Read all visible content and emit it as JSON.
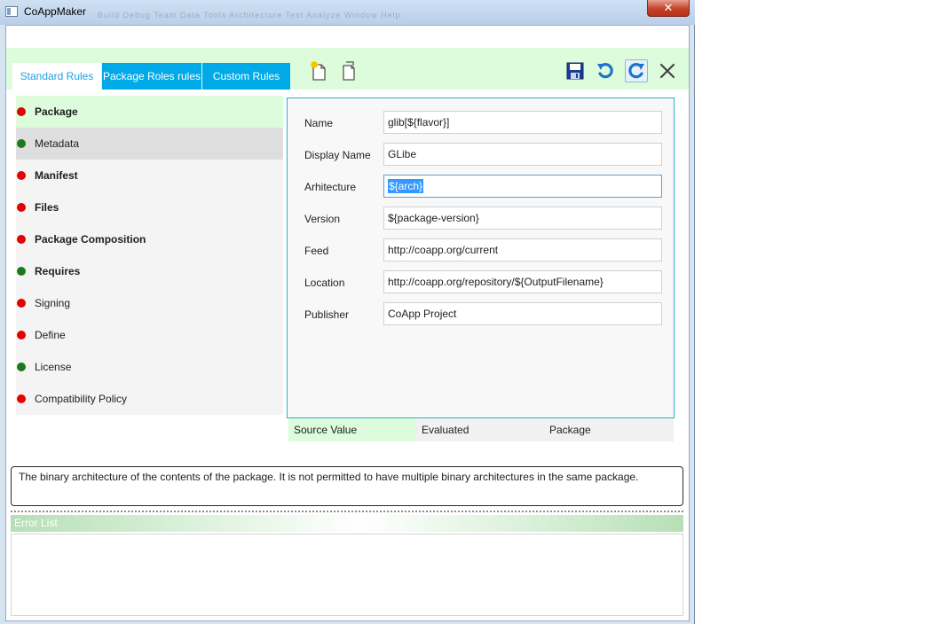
{
  "window": {
    "title": "CoAppMaker",
    "close_glyph": "✕",
    "blurred_menu": "Build   Debug   Team   Data   Tools   Architecture   Test   Analyze   Window   Help"
  },
  "tabs": [
    {
      "label": "Standard Rules",
      "selected": true
    },
    {
      "label": "Package Roles rules",
      "selected": false
    },
    {
      "label": "Custom Rules",
      "selected": false
    }
  ],
  "toolbar": {
    "left_icons": [
      "new-rule-icon",
      "copy-rule-icon"
    ],
    "right_icons": [
      "save-icon",
      "undo-icon",
      "redo-icon",
      "close-icon"
    ]
  },
  "sidebar": {
    "items": [
      {
        "label": "Package",
        "status": "red",
        "bold": true,
        "selected": true
      },
      {
        "label": "Metadata",
        "status": "green",
        "bold": false,
        "hover": true
      },
      {
        "label": "Manifest",
        "status": "red",
        "bold": true
      },
      {
        "label": "Files",
        "status": "red",
        "bold": true
      },
      {
        "label": "Package Composition",
        "status": "red",
        "bold": true
      },
      {
        "label": "Requires",
        "status": "green",
        "bold": true
      },
      {
        "label": "Signing",
        "status": "red",
        "bold": false
      },
      {
        "label": "Define",
        "status": "red",
        "bold": false
      },
      {
        "label": "License",
        "status": "green",
        "bold": false
      },
      {
        "label": "Compatibility Policy",
        "status": "red",
        "bold": false
      }
    ]
  },
  "form": {
    "fields": [
      {
        "label": "Name",
        "value": "glib[${flavor}]"
      },
      {
        "label": "Display Name",
        "value": "GLibe"
      },
      {
        "label": "Arhitecture",
        "value": "${arch}",
        "focused": true
      },
      {
        "label": "Version",
        "value": "${package-version}"
      },
      {
        "label": "Feed",
        "value": "http://coapp.org/current"
      },
      {
        "label": "Location",
        "value": "http://coapp.org/repository/${OutputFilename}"
      },
      {
        "label": "Publisher",
        "value": "CoApp Project"
      }
    ]
  },
  "subtabs": [
    {
      "label": "Source Value",
      "selected": true
    },
    {
      "label": "Evaluated",
      "selected": false
    },
    {
      "label": "Package",
      "selected": false
    }
  ],
  "description": "The binary architecture of the contents of the package. It is not permitted to have multiple binary architectures in the same package.",
  "error_list": {
    "title": "Error List"
  },
  "colors": {
    "accent": "#00a9e8",
    "status_red": "#e60000",
    "status_green": "#1a7a1a",
    "header_green": "#dcfcdc"
  }
}
